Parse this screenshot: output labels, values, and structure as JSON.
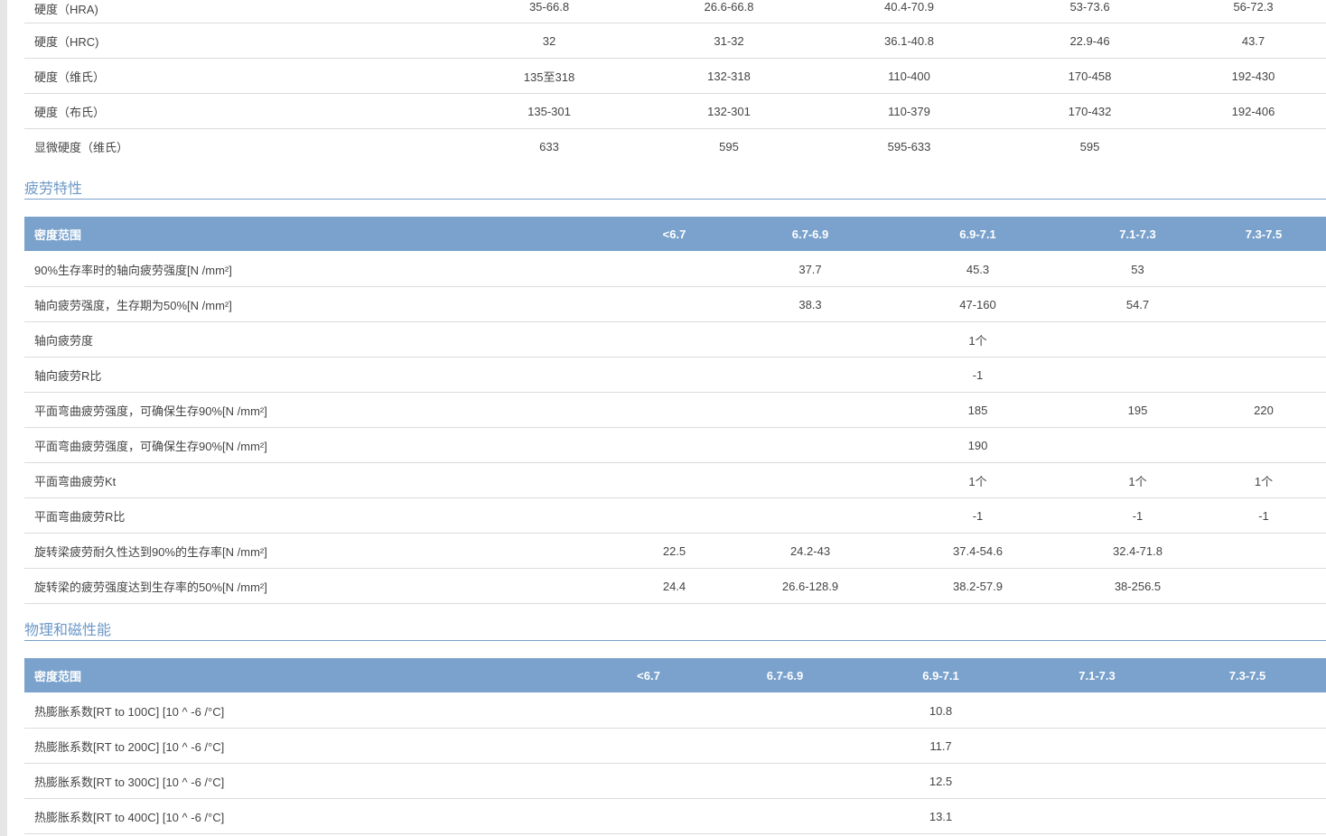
{
  "hardness": {
    "rows": [
      {
        "label": "硬度（HRA)",
        "values": [
          "35-66.8",
          "26.6-66.8",
          "40.4-70.9",
          "53-73.6",
          "56-72.3"
        ]
      },
      {
        "label": "硬度（HRC)",
        "values": [
          "32",
          "31-32",
          "36.1-40.8",
          "22.9-46",
          "43.7"
        ]
      },
      {
        "label": "硬度（维氏）",
        "values": [
          "135至318",
          "132-318",
          "110-400",
          "170-458",
          "192-430"
        ]
      },
      {
        "label": "硬度（布氏）",
        "values": [
          "135-301",
          "132-301",
          "110-379",
          "170-432",
          "192-406"
        ]
      },
      {
        "label": "显微硬度（维氏）",
        "values": [
          "633",
          "595",
          "595-633",
          "595",
          ""
        ]
      }
    ]
  },
  "fatigue": {
    "title": "疲劳特性",
    "headers": [
      "密度范围",
      "<6.7",
      "6.7-6.9",
      "6.9-7.1",
      "7.1-7.3",
      "7.3-7.5"
    ],
    "rows": [
      {
        "label": "90%生存率时的轴向疲劳强度[N /mm²]",
        "values": [
          "",
          "37.7",
          "45.3",
          "53",
          ""
        ]
      },
      {
        "label": "轴向疲劳强度，生存期为50%[N /mm²]",
        "values": [
          "",
          "38.3",
          "47-160",
          "54.7",
          ""
        ]
      },
      {
        "label": "轴向疲劳度",
        "values": [
          "",
          "",
          "1个",
          "",
          ""
        ]
      },
      {
        "label": "轴向疲劳R比",
        "values": [
          "",
          "",
          "-1",
          "",
          ""
        ]
      },
      {
        "label": "平面弯曲疲劳强度，可确保生存90%[N /mm²]",
        "values": [
          "",
          "",
          "185",
          "195",
          "220"
        ]
      },
      {
        "label": "平面弯曲疲劳强度，可确保生存90%[N /mm²]",
        "values": [
          "",
          "",
          "190",
          "",
          ""
        ]
      },
      {
        "label": "平面弯曲疲劳Kt",
        "values": [
          "",
          "",
          "1个",
          "1个",
          "1个"
        ]
      },
      {
        "label": "平面弯曲疲劳R比",
        "values": [
          "",
          "",
          "-1",
          "-1",
          "-1"
        ]
      },
      {
        "label": "旋转梁疲劳耐久性达到90%的生存率[N /mm²]",
        "values": [
          "22.5",
          "24.2-43",
          "37.4-54.6",
          "32.4-71.8",
          ""
        ]
      },
      {
        "label": "旋转梁的疲劳强度达到生存率的50%[N /mm²]",
        "values": [
          "24.4",
          "26.6-128.9",
          "38.2-57.9",
          "38-256.5",
          ""
        ]
      }
    ]
  },
  "physical": {
    "title": "物理和磁性能",
    "headers": [
      "密度范围",
      "<6.7",
      "6.7-6.9",
      "6.9-7.1",
      "7.1-7.3",
      "7.3-7.5"
    ],
    "rows": [
      {
        "label": "热膨胀系数[RT to 100C] [10 ^ -6 /°C]",
        "values": [
          "",
          "",
          "10.8",
          "",
          ""
        ]
      },
      {
        "label": "热膨胀系数[RT to 200C] [10 ^ -6 /°C]",
        "values": [
          "",
          "",
          "11.7",
          "",
          ""
        ]
      },
      {
        "label": "热膨胀系数[RT to 300C] [10 ^ -6 /°C]",
        "values": [
          "",
          "",
          "12.5",
          "",
          ""
        ]
      },
      {
        "label": "热膨胀系数[RT to 400C] [10 ^ -6 /°C]",
        "values": [
          "",
          "",
          "13.1",
          "",
          ""
        ]
      }
    ]
  }
}
